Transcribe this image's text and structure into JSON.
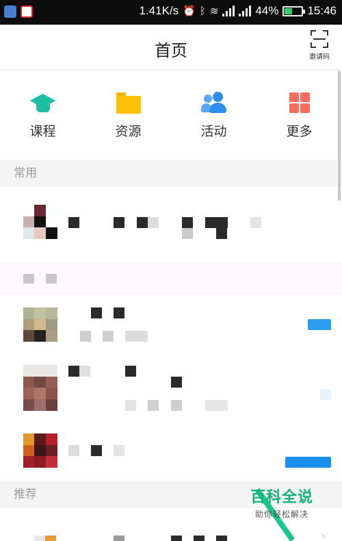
{
  "status_bar": {
    "speed": "1.41K/s",
    "battery": "44%",
    "battery_level": 0.44,
    "time": "15:46"
  },
  "header": {
    "title": "首页",
    "invite_label": "邀请码"
  },
  "quick_nav": [
    {
      "label": "课程",
      "icon": "graduation-cap-icon",
      "color": "#1dbfa3"
    },
    {
      "label": "资源",
      "icon": "folder-icon",
      "color": "#ffc107"
    },
    {
      "label": "活动",
      "icon": "people-icon",
      "color": "#2d8cf0"
    },
    {
      "label": "更多",
      "icon": "grid-icon",
      "color": "#f76b5a"
    }
  ],
  "sections": {
    "common": "常用",
    "recommend": "推荐"
  },
  "watermark": {
    "title": "百科全说",
    "subtitle": "助你轻松解决"
  }
}
